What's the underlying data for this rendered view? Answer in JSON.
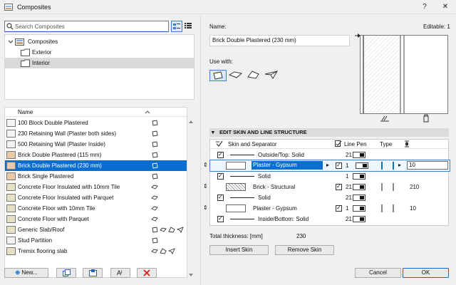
{
  "window": {
    "title": "Composites",
    "help_label": "?",
    "close_label": "✕"
  },
  "search": {
    "placeholder": "Search Composites"
  },
  "tree": {
    "root": "Composites",
    "children": [
      "Exterior",
      "Interior"
    ],
    "selected": "Interior"
  },
  "list": {
    "header_name": "Name",
    "items": [
      {
        "name": "100 Block Double Plastered",
        "selected": false
      },
      {
        "name": "230 Retaining Wall (Plaster both sides)",
        "selected": false
      },
      {
        "name": "500 Retaining Wall (Plaster Inside)",
        "selected": false
      },
      {
        "name": "Brick Double Plastered (115 mm)",
        "selected": false
      },
      {
        "name": "Brick Double Plastered (230 mm)",
        "selected": true
      },
      {
        "name": "Brick Single Plastered",
        "selected": false
      },
      {
        "name": "Concrete Floor Insulated with 10mm Tile",
        "selected": false
      },
      {
        "name": "Concrete Floor Insulated with Parquet",
        "selected": false
      },
      {
        "name": "Concrete Floor with 10mm Tile",
        "selected": false
      },
      {
        "name": "Concrete Floor with Parquet",
        "selected": false
      },
      {
        "name": "Generic Slab/Roof",
        "selected": false
      },
      {
        "name": "Stud Partition",
        "selected": false
      },
      {
        "name": "Tremix flooring slab",
        "selected": false
      }
    ]
  },
  "left_buttons": {
    "new_label": "New...",
    "duplicate_icon": "duplicate-icon",
    "import_icon": "import-icon",
    "rename_icon": "rename-icon",
    "delete_icon": "delete-icon"
  },
  "details": {
    "name_label": "Name:",
    "name_value": "Brick Double Plastered (230 mm)",
    "editable_label": "Editable: 1",
    "use_with_label": "Use with:"
  },
  "structure": {
    "section_title": "EDIT SKIN AND LINE STRUCTURE",
    "col_skin": "Skin and Separator",
    "col_line_pen": "Line Pen",
    "col_type": "Type",
    "rows": [
      {
        "kind": "line",
        "label": "Outside/Top: Solid",
        "pen": "21",
        "thickness": ""
      },
      {
        "kind": "skin",
        "label": "Plaster - Gypsum",
        "pen": "1",
        "thickness": "10",
        "selected": true
      },
      {
        "kind": "line",
        "label": "Solid",
        "pen": "1",
        "thickness": ""
      },
      {
        "kind": "skin",
        "label": "Brick - Structural",
        "pen": "21",
        "thickness": "210",
        "selected": false
      },
      {
        "kind": "line",
        "label": "Solid",
        "pen": "21",
        "thickness": ""
      },
      {
        "kind": "skin",
        "label": "Plaster - Gypsum",
        "pen": "1",
        "thickness": "10",
        "selected": false
      },
      {
        "kind": "line",
        "label": "Inside/Bottom: Solid",
        "pen": "21",
        "thickness": ""
      }
    ],
    "total_label": "Total thickness: [mm]",
    "total_value": "230",
    "insert_label": "Insert Skin",
    "remove_label": "Remove Skin"
  },
  "footer": {
    "cancel_label": "Cancel",
    "ok_label": "OK"
  },
  "colors": {
    "accent": "#0a6ed1",
    "brick_swatch": "#e8c9a8"
  }
}
